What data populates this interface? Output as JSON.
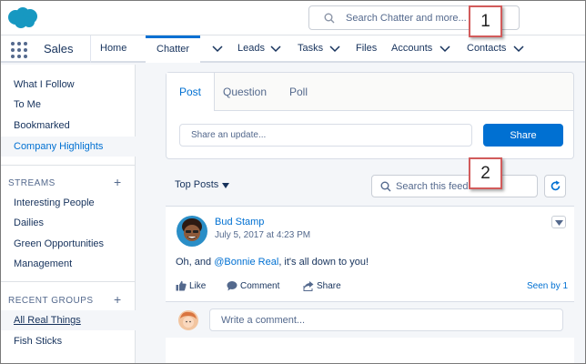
{
  "brand": {
    "logo_icon": "salesforce-cloud-icon",
    "color": "#1798c1"
  },
  "search": {
    "placeholder": "Search Chatter and more..."
  },
  "nav": {
    "app_name": "Sales",
    "home": "Home",
    "chatter": "Chatter",
    "leads": "Leads",
    "tasks": "Tasks",
    "files": "Files",
    "accounts": "Accounts",
    "contacts": "Contacts",
    "accent": "#0070d2"
  },
  "sidebar": {
    "links": [
      "What I Follow",
      "To Me",
      "Bookmarked",
      "Company Highlights"
    ],
    "streams_heading": "STREAMS",
    "streams": [
      "Interesting People",
      "Dailies",
      "Green Opportunities",
      "Management"
    ],
    "groups_heading": "RECENT GROUPS",
    "groups": [
      "All Real Things",
      "Fish Sticks"
    ]
  },
  "publisher": {
    "tabs": [
      "Post",
      "Question",
      "Poll"
    ],
    "input_placeholder": "Share an update...",
    "share_label": "Share"
  },
  "feed": {
    "sort_label": "Top Posts",
    "search_placeholder": "Search this feed"
  },
  "post": {
    "author": "Bud Stamp",
    "timestamp": "July 5, 2017 at 4:23 PM",
    "body_prefix": "Oh, and ",
    "mention": "@Bonnie Real",
    "body_suffix": ", it's all down to you!",
    "like": "Like",
    "comment": "Comment",
    "share": "Share",
    "seen_by": "Seen by 1",
    "comment_placeholder": "Write a comment..."
  },
  "callouts": [
    "1",
    "2"
  ],
  "callout_color": "#d25b5b"
}
